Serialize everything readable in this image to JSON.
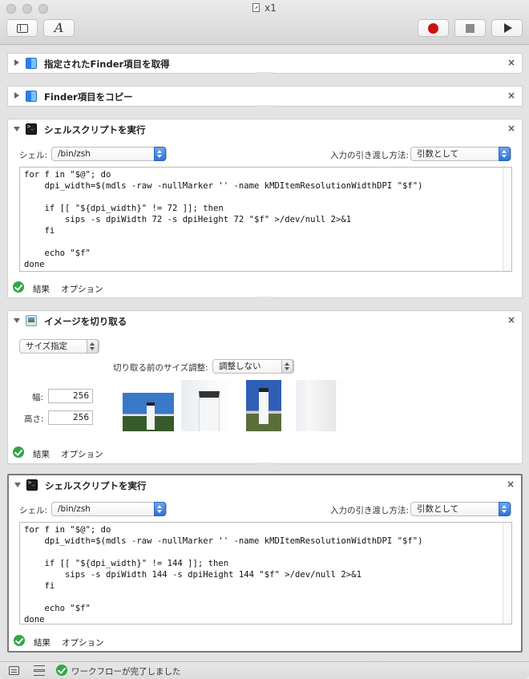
{
  "window": {
    "title": "x1"
  },
  "toolbar": {
    "library_icon": "sidebar-icon",
    "variables_icon": "italic-a-icon",
    "record_icon": "record-icon",
    "stop_icon": "stop-icon",
    "run_icon": "play-icon",
    "record_color": "#cc1111"
  },
  "actions": [
    {
      "title": "指定されたFinder項目を取得",
      "collapsed": true
    },
    {
      "title": "Finder項目をコピー",
      "collapsed": true
    },
    {
      "title": "シェルスクリプトを実行",
      "shell_label": "シェル:",
      "shell_value": "/bin/zsh",
      "pass_label": "入力の引き渡し方法:",
      "pass_value": "引数として",
      "script": "for f in \"$@\"; do\n    dpi_width=$(mdls -raw -nullMarker '' -name kMDItemResolutionWidthDPI \"$f\")\n\n    if [[ \"${dpi_width}\" != 72 ]]; then\n        sips -s dpiWidth 72 -s dpiHeight 72 \"$f\" >/dev/null 2>&1\n    fi\n\n    echo \"$f\"\ndone",
      "footer": {
        "results": "結果",
        "options": "オプション"
      }
    },
    {
      "title": "イメージを切り取る",
      "mode_value": "サイズ指定",
      "scale_label": "切り取る前のサイズ調整:",
      "scale_value": "調整しない",
      "width_label": "幅:",
      "width_value": "256",
      "height_label": "高さ:",
      "height_value": "256",
      "footer": {
        "results": "結果",
        "options": "オプション"
      }
    },
    {
      "title": "シェルスクリプトを実行",
      "shell_label": "シェル:",
      "shell_value": "/bin/zsh",
      "pass_label": "入力の引き渡し方法:",
      "pass_value": "引数として",
      "script": "for f in \"$@\"; do\n    dpi_width=$(mdls -raw -nullMarker '' -name kMDItemResolutionWidthDPI \"$f\")\n\n    if [[ \"${dpi_width}\" != 144 ]]; then\n        sips -s dpiWidth 144 -s dpiHeight 144 \"$f\" >/dev/null 2>&1\n    fi\n\n    echo \"$f\"\ndone",
      "footer": {
        "results": "結果",
        "options": "オプション"
      }
    }
  ],
  "close_glyph": "×",
  "status": {
    "message": "ワークフローが完了しました"
  }
}
